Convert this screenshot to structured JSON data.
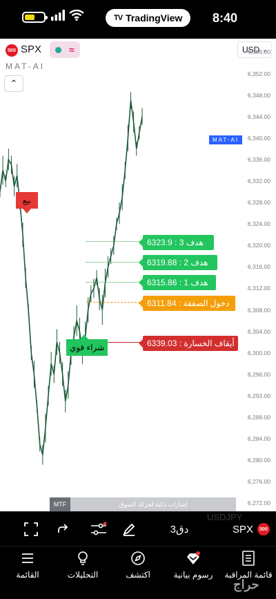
{
  "status_bar": {
    "app_pill_label": "TradingView",
    "time": "8:40",
    "battery_level": 0.5
  },
  "chart_header": {
    "symbol_badge": "500",
    "symbol": "SPX",
    "currency": "USD",
    "indicator_name": "MAT-AI",
    "market_status_icon": "approx-icon",
    "collapse_icon": "chevron-up-icon"
  },
  "price_axis": {
    "ticks": [
      "6,356.00",
      "6,352.00",
      "6,348.00",
      "6,344.00",
      "6,340.00",
      "6,336.00",
      "6,332.00",
      "6,328.00",
      "6,324.00",
      "6,320.00",
      "6,316.00",
      "6,312.00",
      "6,308.00",
      "6,304.00",
      "6,300.00",
      "6,296.00",
      "6,292.00",
      "6,288.00",
      "6,284.00",
      "6,280.00",
      "6,276.00",
      "6,272.00"
    ],
    "indicator_tag": "MAT-AI"
  },
  "signals": {
    "sell_label": "بيع",
    "buy_label": "شراء قوي"
  },
  "levels": [
    {
      "label": "هدف 3 : 6323.9",
      "kind": "target"
    },
    {
      "label": "هدف 2 : 6319.88",
      "kind": "target"
    },
    {
      "label": "هدف 1 : 6315.86",
      "kind": "target"
    },
    {
      "label": "دخول الصفقة : 6311.84",
      "kind": "entry"
    },
    {
      "label": "أيقاف الخسارة : 6339.03",
      "kind": "stop"
    }
  ],
  "mtf_table": {
    "header_cell": "MTF",
    "title": "إشارات ذكية لحركة السوق"
  },
  "toolbar": {
    "interval": "3دق",
    "symbol": "SPX",
    "symbol_badge": "500",
    "icons": [
      "fullscreen-icon",
      "redo-icon",
      "indicators-icon",
      "draw-icon"
    ]
  },
  "bottom_nav": [
    {
      "label": "القائمة",
      "icon": "menu-icon"
    },
    {
      "label": "التحليلات",
      "icon": "ideas-icon"
    },
    {
      "label": "اكتشف",
      "icon": "explore-icon"
    },
    {
      "label": "رسوم بيانية",
      "icon": "chart-icon"
    },
    {
      "label": "قائمة المراقبة",
      "icon": "watchlist-icon"
    }
  ],
  "watermark": "حراج",
  "colors": {
    "target": "#22c55e",
    "entry": "#f59e0b",
    "stop": "#d32f2f",
    "indicator_tag": "#2962ff",
    "candle": "#1e5b3a"
  },
  "chart_data": {
    "type": "line",
    "title": "",
    "xlabel": "",
    "ylabel": "",
    "ylim": [
      6270.5,
      6358.5
    ],
    "y_ticks": [
      6356,
      6352,
      6348,
      6344,
      6340,
      6336,
      6332,
      6328,
      6324,
      6320,
      6316,
      6312,
      6308,
      6304,
      6300,
      6296,
      6292,
      6288,
      6284,
      6280,
      6276,
      6272
    ],
    "series": [
      {
        "values": [
          6330,
          6334,
          6332,
          6336,
          6335,
          6331,
          6333,
          6328,
          6322,
          6314,
          6308,
          6300,
          6296,
          6290,
          6283,
          6281,
          6286,
          6292,
          6298,
          6296,
          6302,
          6300,
          6296,
          6291,
          6294,
          6300,
          6303,
          6306,
          6304,
          6300,
          6303,
          6308,
          6311,
          6312,
          6314,
          6310,
          6308,
          6313,
          6316,
          6318,
          6320,
          6324,
          6326,
          6329,
          6334,
          6340,
          6347,
          6343,
          6338,
          6341,
          6344
        ]
      }
    ],
    "levels": [
      {
        "name": "هدف 3",
        "value": 6323.9
      },
      {
        "name": "هدف 2",
        "value": 6319.88
      },
      {
        "name": "هدف 1",
        "value": 6315.86
      },
      {
        "name": "دخول الصفقة",
        "value": 6311.84
      },
      {
        "name": "أيقاف الخسارة",
        "value": 6339.03
      }
    ]
  }
}
